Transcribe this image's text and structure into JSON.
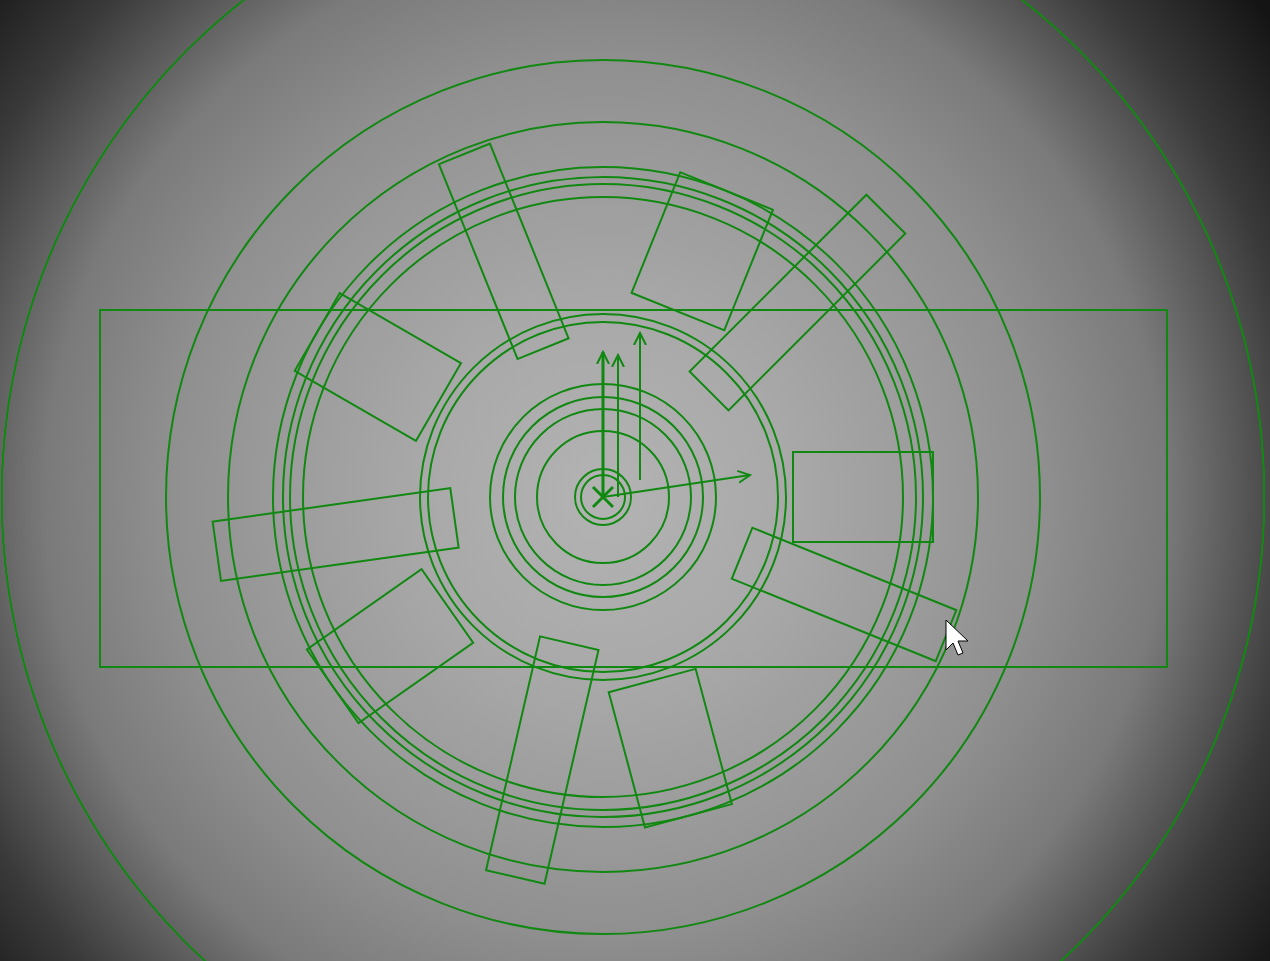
{
  "camera_view": {
    "overlays_visible": true,
    "cursor_visible": true
  }
}
